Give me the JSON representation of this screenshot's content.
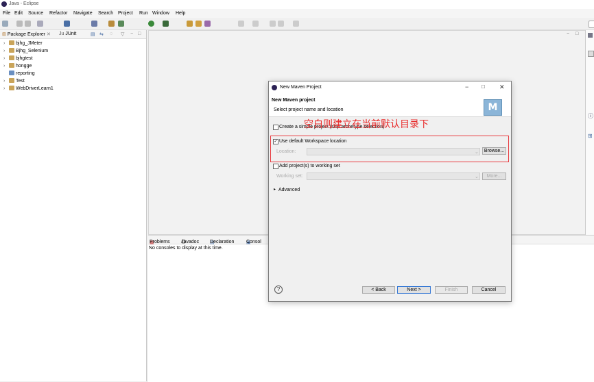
{
  "window": {
    "title": "Java - Eclipse"
  },
  "menu": [
    "File",
    "Edit",
    "Source",
    "Refactor",
    "Navigate",
    "Search",
    "Project",
    "Run",
    "Window",
    "Help"
  ],
  "left_tabs": {
    "package_explorer": "Package Explorer",
    "junit": "JUnit"
  },
  "projects": [
    "bjhg_JMeter",
    "Bjhg_Selenium",
    "bjhgtest",
    "hongge",
    "reporting",
    "Test",
    "WebDriverLearn1"
  ],
  "console": {
    "tabs": [
      "Problems",
      "Javadoc",
      "Declaration",
      "Consol"
    ],
    "message": "No consoles to display at this time."
  },
  "dialog": {
    "title": "New Maven Project",
    "header_title": "New Maven project",
    "header_subtitle": "Select project name and location",
    "simple_project_label": "Create a simple project (skip archetype selection)",
    "use_default_label": "Use default Workspace location",
    "location_label": "Location:",
    "browse_label": "Browse...",
    "add_working_set_label": "Add project(s) to working set",
    "working_set_label": "Working set:",
    "more_label": "More...",
    "advanced_label": "Advanced",
    "back_label": "< Back",
    "next_label": "Next >",
    "finish_label": "Finish",
    "cancel_label": "Cancel",
    "help_icon": "?",
    "logo_letter": "M"
  },
  "annotation": {
    "text": "空白则建立在当前默认目录下",
    "color": "#e82a2a"
  }
}
